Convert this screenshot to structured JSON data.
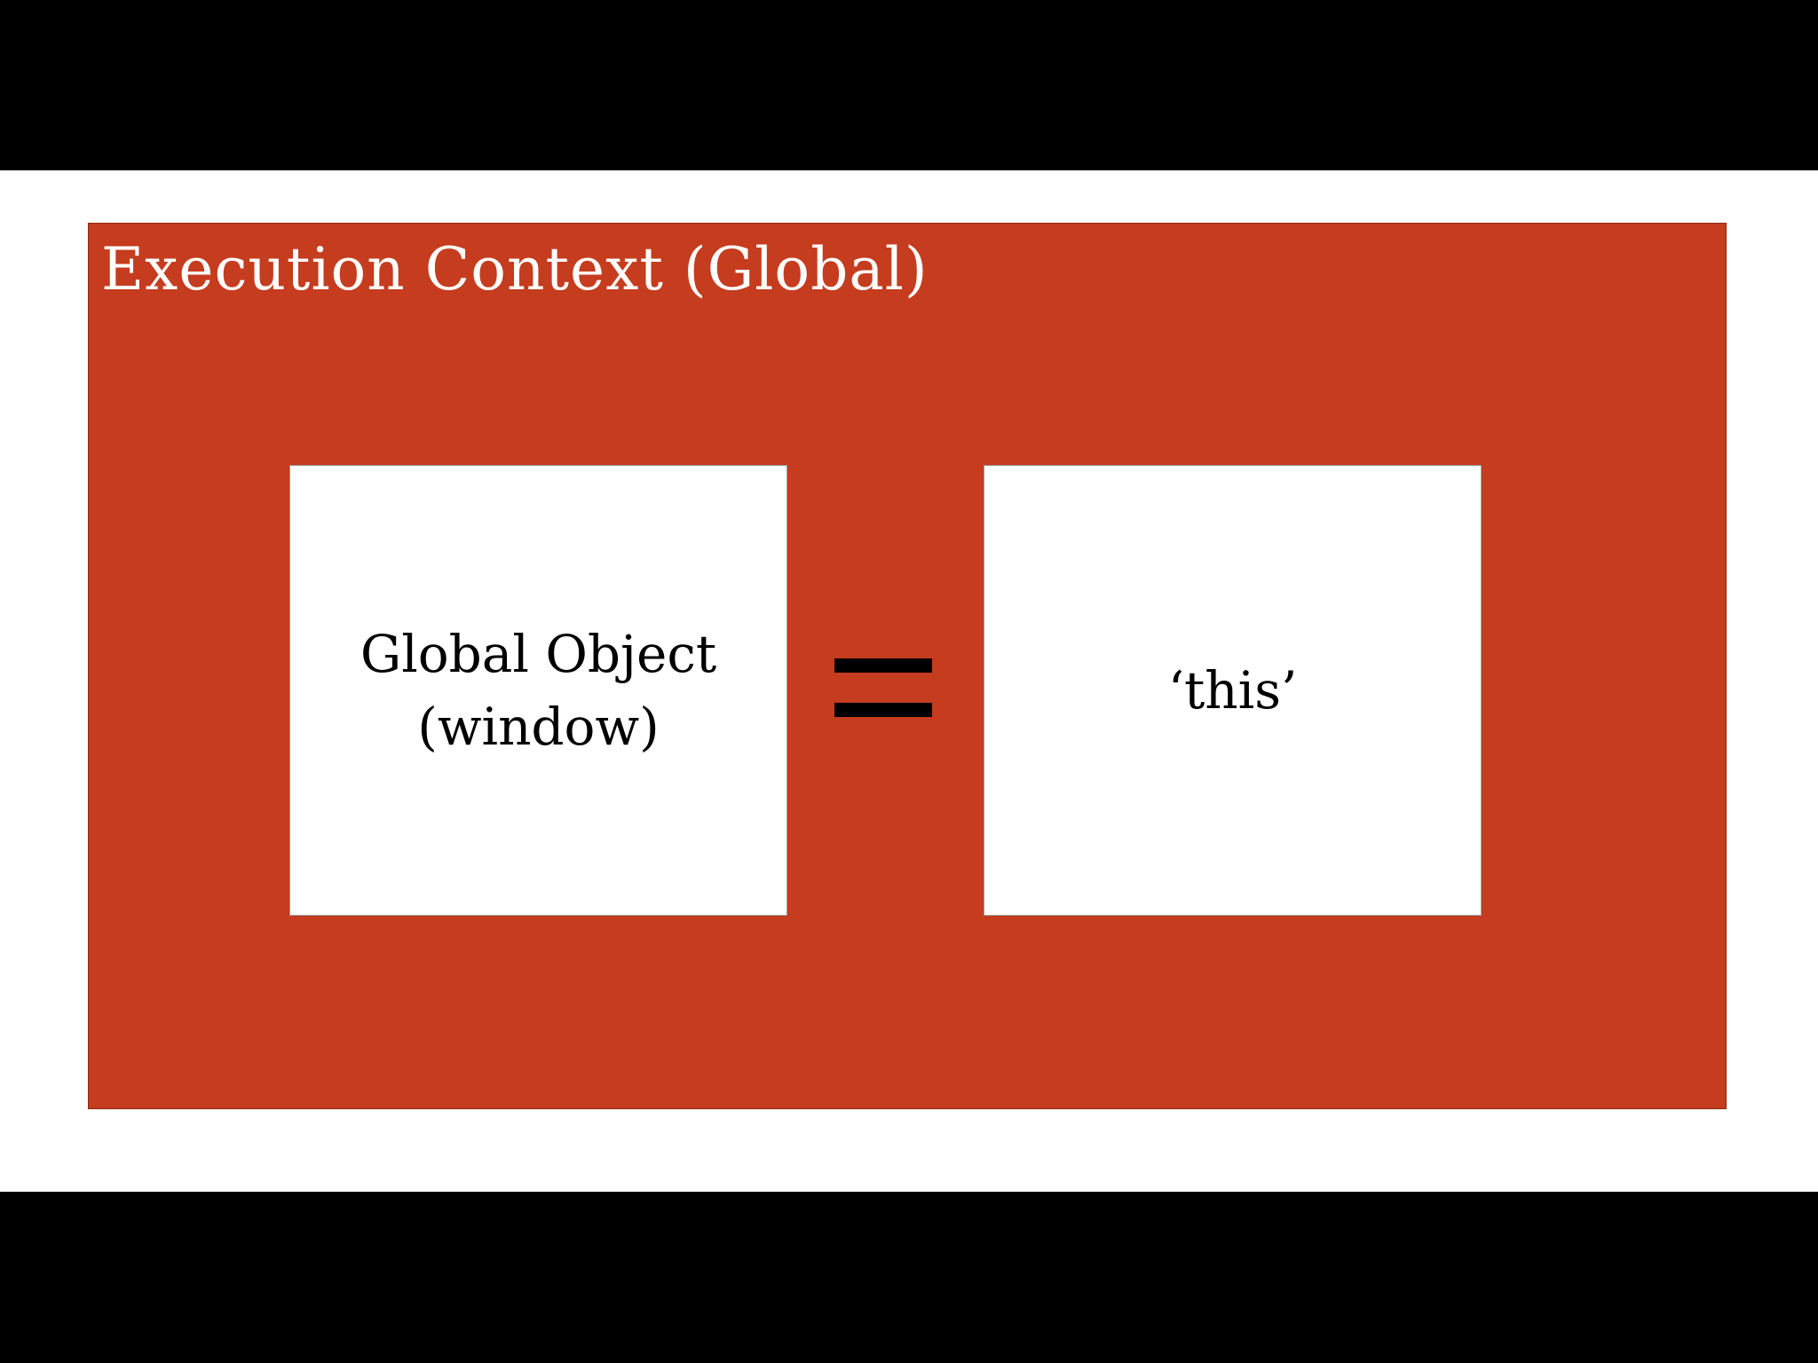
{
  "slide": {
    "title": "Execution Context (Global)",
    "left_box": {
      "line1": "Global Object",
      "line2": "(window)"
    },
    "operator": "=",
    "right_box": {
      "label": "‘this’"
    }
  },
  "colors": {
    "panel": "#c53c1e",
    "box": "#ffffff",
    "letterbox": "#000000",
    "title_text": "#ffffff"
  }
}
